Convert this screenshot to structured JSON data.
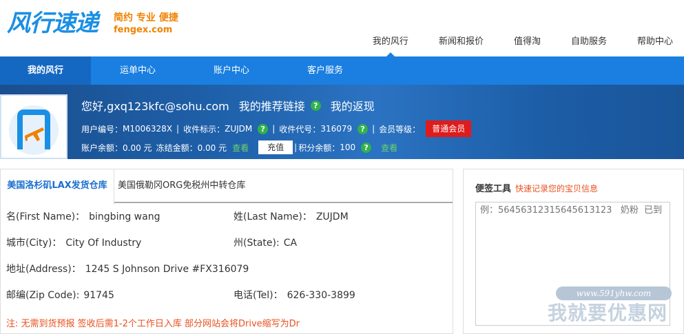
{
  "header": {
    "logo_text": "风行速递",
    "tagline": "简约 专业 便捷",
    "domain": "fengex.com",
    "top_nav": [
      "我的风行",
      "新闻和报价",
      "值得淘",
      "自助服务",
      "帮助中心"
    ]
  },
  "navbar": {
    "items": [
      "我的风行",
      "运单中心",
      "账户中心",
      "客户服务"
    ]
  },
  "profile": {
    "greeting": "您好,gxq123kfc@sohu.com",
    "referral_link": "我的推荐链接",
    "rebate": "我的返现",
    "user_id_label": "用户编号：",
    "user_id": "M1006328X",
    "receive_mark_label": "收件标示：",
    "receive_mark": "ZUJDM",
    "receive_code_label": "收件代号：",
    "receive_code": "316079",
    "level_label": "会员等级：",
    "level": "普通会员",
    "balance_label": "账户余额：",
    "balance": "0.00 元",
    "frozen_label": "冻结金额：",
    "frozen": "0.00 元",
    "view": "查看",
    "recharge": "充值",
    "points_label": "积分余额：",
    "points": "100",
    "help_glyph": "?",
    "separator": "|"
  },
  "address": {
    "tabs": [
      "美国洛杉矶LAX发货仓库",
      "美国俄勒冈ORG免税州中转仓库"
    ],
    "first_name_label": "名(First Name)：",
    "first_name": "bingbing wang",
    "last_name_label": "姓(Last Name)：",
    "last_name": "ZUJDM",
    "city_label": "城市(City)：",
    "city": "City Of Industry",
    "state_label": "州(State):",
    "state": "CA",
    "address_label": "地址(Address)：",
    "address": "1245 S Johnson Drive #FX316079",
    "zip_label": "邮编(Zip Code):",
    "zip": "91745",
    "tel_label": "电话(Tel)：",
    "tel": "626-330-3899",
    "note": "注: 无需到货预报 签收后需1-2个工作日入库 部分网站会将Drive缩写为Dr"
  },
  "sticky": {
    "title": "便签工具",
    "subtitle": "快速记录您的宝贝信息",
    "placeholder": "例：56456312315645613123   奶粉  已到"
  },
  "watermark": {
    "url": "www.591yhw.com",
    "text": "我就要优惠网"
  },
  "colors": {
    "brand_blue": "#1a7fe0",
    "accent_orange": "#f08200",
    "badge_red": "#e01b1b",
    "help_green": "#31b24a"
  }
}
